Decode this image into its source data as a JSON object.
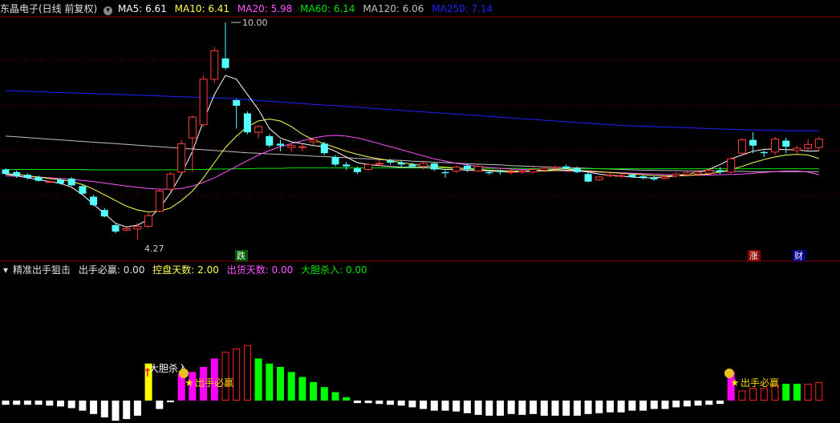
{
  "header": {
    "stock_title": "东晶电子(日线 前复权)",
    "ma5": "MA5: 6.61",
    "ma10": "MA10: 6.41",
    "ma20": "MA20: 5.98",
    "ma60": "MA60: 6.14",
    "ma120": "MA120: 6.06",
    "ma250": "MA250: 7.14"
  },
  "colors": {
    "up": "#ff3c3c",
    "down": "#54ffff",
    "ma5": "#ffffff",
    "ma10": "#ffff54",
    "ma20": "#ff54ff",
    "ma60": "#00e600",
    "ma120": "#c0c0c0",
    "ma250": "#2020ff",
    "grid": "#8b0000"
  },
  "indicator": {
    "title": "精准出手狙击",
    "v1": "出手必赢: 0.00",
    "v2": "控盘天数: 2.00",
    "v3": "出货天数: 0.00",
    "v4": "大胆杀入: 0.00"
  },
  "markers": {
    "high_label": "10.00",
    "low_label": "4.27",
    "die": "跌",
    "zhang": "涨",
    "cai": "财"
  },
  "signals": {
    "dadan": "大胆杀入",
    "bishou1": "出手必赢",
    "bishou2": "出手必赢"
  },
  "chart_data": [
    {
      "type": "candlestick",
      "title": "东晶电子(日线 前复权)",
      "candles": [
        {
          "o": 6.12,
          "c": 6.0,
          "h": 6.15,
          "l": 5.98
        },
        {
          "o": 6.05,
          "c": 5.95,
          "h": 6.1,
          "l": 5.9
        },
        {
          "o": 5.98,
          "c": 5.9,
          "h": 6.02,
          "l": 5.85
        },
        {
          "o": 5.92,
          "c": 5.82,
          "h": 5.96,
          "l": 5.8
        },
        {
          "o": 5.8,
          "c": 5.8,
          "h": 5.84,
          "l": 5.76
        },
        {
          "o": 5.85,
          "c": 5.75,
          "h": 5.88,
          "l": 5.72
        },
        {
          "o": 5.88,
          "c": 5.7,
          "h": 5.92,
          "l": 5.68
        },
        {
          "o": 5.68,
          "c": 5.48,
          "h": 5.72,
          "l": 5.45
        },
        {
          "o": 5.4,
          "c": 5.18,
          "h": 5.45,
          "l": 5.15
        },
        {
          "o": 5.05,
          "c": 4.88,
          "h": 5.1,
          "l": 4.86
        },
        {
          "o": 4.65,
          "c": 4.48,
          "h": 4.7,
          "l": 4.44
        },
        {
          "o": 4.52,
          "c": 4.56,
          "h": 4.6,
          "l": 4.48
        },
        {
          "o": 4.55,
          "c": 4.62,
          "h": 4.7,
          "l": 4.27
        },
        {
          "o": 4.62,
          "c": 4.9,
          "h": 4.98,
          "l": 4.58
        },
        {
          "o": 5.02,
          "c": 5.55,
          "h": 5.6,
          "l": 4.98
        },
        {
          "o": 5.6,
          "c": 6.0,
          "h": 6.05,
          "l": 5.55
        },
        {
          "o": 6.05,
          "c": 6.8,
          "h": 6.9,
          "l": 6.0
        },
        {
          "o": 6.95,
          "c": 7.5,
          "h": 7.55,
          "l": 6.05
        },
        {
          "o": 7.3,
          "c": 8.5,
          "h": 8.6,
          "l": 7.25
        },
        {
          "o": 8.5,
          "c": 9.25,
          "h": 9.35,
          "l": 8.4
        },
        {
          "o": 9.05,
          "c": 8.8,
          "h": 10.0,
          "l": 8.75
        },
        {
          "o": 7.95,
          "c": 7.8,
          "h": 7.98,
          "l": 7.2
        },
        {
          "o": 7.6,
          "c": 7.1,
          "h": 7.65,
          "l": 7.05
        },
        {
          "o": 7.1,
          "c": 7.25,
          "h": 7.3,
          "l": 6.95
        },
        {
          "o": 7.0,
          "c": 6.75,
          "h": 7.05,
          "l": 6.7
        },
        {
          "o": 6.8,
          "c": 6.75,
          "h": 6.9,
          "l": 6.6
        },
        {
          "o": 6.7,
          "c": 6.75,
          "h": 6.82,
          "l": 6.58
        },
        {
          "o": 6.72,
          "c": 6.72,
          "h": 6.8,
          "l": 6.6
        },
        {
          "o": 6.85,
          "c": 6.9,
          "h": 6.95,
          "l": 6.75
        },
        {
          "o": 6.8,
          "c": 6.55,
          "h": 6.85,
          "l": 6.5
        },
        {
          "o": 6.45,
          "c": 6.25,
          "h": 6.5,
          "l": 6.2
        },
        {
          "o": 6.25,
          "c": 6.2,
          "h": 6.32,
          "l": 6.1
        },
        {
          "o": 6.15,
          "c": 6.05,
          "h": 6.2,
          "l": 6.0
        },
        {
          "o": 6.12,
          "c": 6.25,
          "h": 6.3,
          "l": 6.08
        },
        {
          "o": 6.28,
          "c": 6.28,
          "h": 6.38,
          "l": 6.2
        },
        {
          "o": 6.35,
          "c": 6.3,
          "h": 6.4,
          "l": 6.25
        },
        {
          "o": 6.3,
          "c": 6.25,
          "h": 6.35,
          "l": 6.18
        },
        {
          "o": 6.25,
          "c": 6.2,
          "h": 6.3,
          "l": 6.15
        },
        {
          "o": 6.2,
          "c": 6.28,
          "h": 6.35,
          "l": 6.12
        },
        {
          "o": 6.28,
          "c": 6.12,
          "h": 6.32,
          "l": 6.08
        },
        {
          "o": 6.05,
          "c": 6.02,
          "h": 6.1,
          "l": 5.9
        },
        {
          "o": 6.08,
          "c": 6.18,
          "h": 6.22,
          "l": 6.02
        },
        {
          "o": 6.22,
          "c": 6.12,
          "h": 6.28,
          "l": 6.05
        },
        {
          "o": 6.08,
          "c": 6.2,
          "h": 6.25,
          "l": 6.05
        },
        {
          "o": 6.05,
          "c": 6.02,
          "h": 6.1,
          "l": 5.98
        },
        {
          "o": 6.08,
          "c": 6.05,
          "h": 6.12,
          "l": 5.98
        },
        {
          "o": 6.06,
          "c": 6.06,
          "h": 6.12,
          "l": 5.98
        },
        {
          "o": 6.05,
          "c": 6.08,
          "h": 6.12,
          "l": 6.0
        },
        {
          "o": 6.05,
          "c": 6.12,
          "h": 6.18,
          "l": 6.02
        },
        {
          "o": 6.1,
          "c": 6.15,
          "h": 6.2,
          "l": 6.05
        },
        {
          "o": 6.15,
          "c": 6.18,
          "h": 6.22,
          "l": 6.1
        },
        {
          "o": 6.2,
          "c": 6.15,
          "h": 6.25,
          "l": 6.12
        },
        {
          "o": 6.15,
          "c": 6.05,
          "h": 6.2,
          "l": 6.02
        },
        {
          "o": 6.0,
          "c": 5.8,
          "h": 6.05,
          "l": 5.78
        },
        {
          "o": 5.85,
          "c": 5.92,
          "h": 5.95,
          "l": 5.82
        },
        {
          "o": 5.95,
          "c": 5.98,
          "h": 6.02,
          "l": 5.92
        },
        {
          "o": 5.96,
          "c": 5.96,
          "h": 6.02,
          "l": 5.9
        },
        {
          "o": 5.98,
          "c": 5.92,
          "h": 6.02,
          "l": 5.9
        },
        {
          "o": 5.94,
          "c": 5.9,
          "h": 5.98,
          "l": 5.86
        },
        {
          "o": 5.9,
          "c": 5.86,
          "h": 5.94,
          "l": 5.82
        },
        {
          "o": 5.88,
          "c": 5.92,
          "h": 5.96,
          "l": 5.85
        },
        {
          "o": 5.95,
          "c": 6.0,
          "h": 6.05,
          "l": 5.9
        },
        {
          "o": 5.98,
          "c": 6.03,
          "h": 6.06,
          "l": 5.94
        },
        {
          "o": 6.0,
          "c": 6.05,
          "h": 6.12,
          "l": 5.96
        },
        {
          "o": 6.02,
          "c": 6.1,
          "h": 6.15,
          "l": 6.0
        },
        {
          "o": 6.1,
          "c": 6.05,
          "h": 6.18,
          "l": 6.0
        },
        {
          "o": 6.05,
          "c": 6.4,
          "h": 6.45,
          "l": 6.02
        },
        {
          "o": 6.55,
          "c": 6.9,
          "h": 6.95,
          "l": 6.5
        },
        {
          "o": 6.9,
          "c": 6.75,
          "h": 7.1,
          "l": 6.55
        },
        {
          "o": 6.58,
          "c": 6.55,
          "h": 6.62,
          "l": 6.45
        },
        {
          "o": 6.58,
          "c": 6.92,
          "h": 6.98,
          "l": 6.5
        },
        {
          "o": 6.88,
          "c": 6.72,
          "h": 6.95,
          "l": 6.55
        },
        {
          "o": 6.62,
          "c": 6.68,
          "h": 6.75,
          "l": 6.55
        },
        {
          "o": 6.68,
          "c": 6.78,
          "h": 6.92,
          "l": 6.62
        },
        {
          "o": 6.7,
          "c": 6.92,
          "h": 6.98,
          "l": 6.62
        }
      ],
      "ma5": [
        6.0,
        5.95,
        5.9,
        5.85,
        5.8,
        5.75,
        5.65,
        5.45,
        5.2,
        4.95,
        4.7,
        4.6,
        4.65,
        4.8,
        5.1,
        5.5,
        6.0,
        6.6,
        7.4,
        8.1,
        8.6,
        8.5,
        8.1,
        7.7,
        7.2,
        6.95,
        6.85,
        6.8,
        6.75,
        6.72,
        6.6,
        6.45,
        6.3,
        6.25,
        6.22,
        6.2,
        6.18,
        6.18,
        6.18,
        6.15,
        6.12,
        6.12,
        6.1,
        6.1,
        6.08,
        6.06,
        6.05,
        6.06,
        6.08,
        6.1,
        6.12,
        6.14,
        6.1,
        6.05,
        6.0,
        5.96,
        5.94,
        5.92,
        5.9,
        5.9,
        5.92,
        5.95,
        6.0,
        6.05,
        6.12,
        6.25,
        6.4,
        6.5,
        6.6,
        6.65,
        6.66,
        6.64,
        6.64,
        6.6,
        6.61
      ],
      "ma10": [
        6.0,
        6.0,
        5.95,
        5.92,
        5.88,
        5.85,
        5.8,
        5.72,
        5.6,
        5.45,
        5.3,
        5.15,
        5.05,
        5.0,
        5.02,
        5.1,
        5.3,
        5.55,
        5.9,
        6.3,
        6.7,
        7.0,
        7.25,
        7.4,
        7.45,
        7.4,
        7.25,
        7.05,
        6.9,
        6.8,
        6.7,
        6.6,
        6.52,
        6.45,
        6.4,
        6.35,
        6.3,
        6.26,
        6.22,
        6.2,
        6.18,
        6.16,
        6.14,
        6.12,
        6.1,
        6.09,
        6.08,
        6.08,
        6.08,
        6.08,
        6.09,
        6.1,
        6.09,
        6.08,
        6.06,
        6.04,
        6.02,
        6.0,
        5.98,
        5.96,
        5.95,
        5.95,
        5.96,
        5.98,
        6.0,
        6.05,
        6.12,
        6.2,
        6.3,
        6.38,
        6.45,
        6.5,
        6.52,
        6.5,
        6.41
      ],
      "ma20": [
        5.95,
        5.94,
        5.93,
        5.92,
        5.9,
        5.88,
        5.86,
        5.83,
        5.8,
        5.76,
        5.72,
        5.68,
        5.65,
        5.62,
        5.6,
        5.6,
        5.62,
        5.68,
        5.78,
        5.9,
        6.05,
        6.2,
        6.35,
        6.5,
        6.62,
        6.72,
        6.8,
        6.88,
        6.95,
        7.0,
        7.02,
        7.0,
        6.95,
        6.88,
        6.8,
        6.72,
        6.64,
        6.56,
        6.48,
        6.4,
        6.34,
        6.28,
        6.24,
        6.2,
        6.17,
        6.15,
        6.13,
        6.12,
        6.11,
        6.1,
        6.09,
        6.08,
        6.07,
        6.06,
        6.05,
        6.04,
        6.03,
        6.02,
        6.01,
        6.0,
        5.99,
        5.98,
        5.97,
        5.97,
        5.97,
        5.98,
        5.99,
        6.0,
        6.02,
        6.04,
        6.06,
        6.08,
        6.08,
        6.05,
        5.98
      ],
      "ma60": [
        6.12,
        6.12,
        6.12,
        6.12,
        6.12,
        6.12,
        6.12,
        6.12,
        6.11,
        6.11,
        6.11,
        6.11,
        6.11,
        6.11,
        6.11,
        6.11,
        6.12,
        6.12,
        6.12,
        6.13,
        6.13,
        6.14,
        6.14,
        6.15,
        6.15,
        6.15,
        6.16,
        6.16,
        6.16,
        6.16,
        6.16,
        6.16,
        6.16,
        6.16,
        6.16,
        6.16,
        6.16,
        6.16,
        6.16,
        6.16,
        6.16,
        6.15,
        6.15,
        6.15,
        6.15,
        6.15,
        6.15,
        6.15,
        6.14,
        6.14,
        6.14,
        6.14,
        6.14,
        6.14,
        6.14,
        6.14,
        6.14,
        6.14,
        6.14,
        6.14,
        6.14,
        6.14,
        6.14,
        6.14,
        6.14,
        6.14,
        6.14,
        6.14,
        6.14,
        6.14,
        6.14,
        6.14,
        6.14,
        6.14,
        6.14
      ],
      "ma120": [
        7.0,
        6.98,
        6.96,
        6.94,
        6.92,
        6.9,
        6.88,
        6.86,
        6.84,
        6.82,
        6.8,
        6.78,
        6.76,
        6.74,
        6.72,
        6.7,
        6.68,
        6.66,
        6.64,
        6.62,
        6.6,
        6.58,
        6.56,
        6.55,
        6.53,
        6.52,
        6.5,
        6.49,
        6.47,
        6.46,
        6.44,
        6.43,
        6.41,
        6.4,
        6.38,
        6.37,
        6.36,
        6.34,
        6.33,
        6.31,
        6.3,
        6.29,
        6.27,
        6.26,
        6.25,
        6.24,
        6.22,
        6.21,
        6.2,
        6.19,
        6.18,
        6.17,
        6.16,
        6.15,
        6.14,
        6.13,
        6.12,
        6.11,
        6.1,
        6.1,
        6.09,
        6.09,
        6.08,
        6.08,
        6.08,
        6.07,
        6.07,
        6.07,
        6.06,
        6.06,
        6.06,
        6.06,
        6.06,
        6.06,
        6.06
      ],
      "ma250": [
        8.2,
        8.19,
        8.18,
        8.17,
        8.16,
        8.15,
        8.14,
        8.13,
        8.12,
        8.11,
        8.1,
        8.09,
        8.08,
        8.07,
        8.06,
        8.05,
        8.04,
        8.03,
        8.02,
        8.01,
        8.0,
        7.98,
        7.96,
        7.94,
        7.92,
        7.9,
        7.88,
        7.86,
        7.84,
        7.82,
        7.8,
        7.78,
        7.76,
        7.74,
        7.72,
        7.7,
        7.68,
        7.66,
        7.64,
        7.62,
        7.6,
        7.58,
        7.56,
        7.54,
        7.52,
        7.5,
        7.48,
        7.46,
        7.44,
        7.42,
        7.4,
        7.38,
        7.36,
        7.34,
        7.32,
        7.3,
        7.28,
        7.27,
        7.26,
        7.25,
        7.24,
        7.23,
        7.22,
        7.21,
        7.2,
        7.19,
        7.18,
        7.17,
        7.16,
        7.15,
        7.15,
        7.14,
        7.14,
        7.14,
        7.14
      ]
    },
    {
      "type": "bar",
      "title": "精准出手狙击",
      "bars": [
        {
          "v": -0.5,
          "k": "w"
        },
        {
          "v": -0.5,
          "k": "w"
        },
        {
          "v": -0.5,
          "k": "w"
        },
        {
          "v": -0.5,
          "k": "w"
        },
        {
          "v": -0.6,
          "k": "w"
        },
        {
          "v": -0.7,
          "k": "w"
        },
        {
          "v": -0.9,
          "k": "w"
        },
        {
          "v": -1.2,
          "k": "w"
        },
        {
          "v": -1.6,
          "k": "w"
        },
        {
          "v": -2.0,
          "k": "w"
        },
        {
          "v": -2.4,
          "k": "w"
        },
        {
          "v": -2.2,
          "k": "w"
        },
        {
          "v": -1.8,
          "k": "w"
        },
        {
          "v": 4.4,
          "k": "y"
        },
        {
          "v": -1.0,
          "k": "w"
        },
        {
          "v": -0.2,
          "k": "w"
        },
        {
          "v": 3.2,
          "k": "m"
        },
        {
          "v": 3.4,
          "k": "m"
        },
        {
          "v": 4.0,
          "k": "m"
        },
        {
          "v": 5.0,
          "k": "m"
        },
        {
          "v": 5.8,
          "k": "r"
        },
        {
          "v": 6.2,
          "k": "r"
        },
        {
          "v": 6.6,
          "k": "r"
        },
        {
          "v": 5.0,
          "k": "g"
        },
        {
          "v": 4.4,
          "k": "g"
        },
        {
          "v": 4.0,
          "k": "g"
        },
        {
          "v": 3.4,
          "k": "g"
        },
        {
          "v": 2.8,
          "k": "g"
        },
        {
          "v": 2.2,
          "k": "g"
        },
        {
          "v": 1.6,
          "k": "g"
        },
        {
          "v": 1.0,
          "k": "g"
        },
        {
          "v": 0.4,
          "k": "g"
        },
        {
          "v": -0.3,
          "k": "w"
        },
        {
          "v": -0.3,
          "k": "w"
        },
        {
          "v": -0.4,
          "k": "w"
        },
        {
          "v": -0.5,
          "k": "w"
        },
        {
          "v": -0.6,
          "k": "w"
        },
        {
          "v": -0.8,
          "k": "w"
        },
        {
          "v": -1.0,
          "k": "w"
        },
        {
          "v": -1.2,
          "k": "w"
        },
        {
          "v": -1.2,
          "k": "w"
        },
        {
          "v": -1.3,
          "k": "w"
        },
        {
          "v": -1.5,
          "k": "w"
        },
        {
          "v": -1.7,
          "k": "w"
        },
        {
          "v": -1.8,
          "k": "w"
        },
        {
          "v": -1.8,
          "k": "w"
        },
        {
          "v": -1.6,
          "k": "w"
        },
        {
          "v": -1.7,
          "k": "w"
        },
        {
          "v": -1.6,
          "k": "w"
        },
        {
          "v": -1.8,
          "k": "w"
        },
        {
          "v": -1.8,
          "k": "w"
        },
        {
          "v": -1.8,
          "k": "w"
        },
        {
          "v": -1.8,
          "k": "w"
        },
        {
          "v": -1.6,
          "k": "w"
        },
        {
          "v": -1.5,
          "k": "w"
        },
        {
          "v": -1.4,
          "k": "w"
        },
        {
          "v": -1.4,
          "k": "w"
        },
        {
          "v": -1.2,
          "k": "w"
        },
        {
          "v": -1.2,
          "k": "w"
        },
        {
          "v": -1.0,
          "k": "w"
        },
        {
          "v": -1.0,
          "k": "w"
        },
        {
          "v": -0.8,
          "k": "w"
        },
        {
          "v": -0.7,
          "k": "w"
        },
        {
          "v": -0.6,
          "k": "w"
        },
        {
          "v": -0.5,
          "k": "w"
        },
        {
          "v": -0.4,
          "k": "w"
        },
        {
          "v": 3.4,
          "k": "m"
        },
        {
          "v": 1.2,
          "k": "r"
        },
        {
          "v": 1.5,
          "k": "r"
        },
        {
          "v": 1.5,
          "k": "r"
        },
        {
          "v": 1.8,
          "k": "r"
        },
        {
          "v": 2.0,
          "k": "g"
        },
        {
          "v": 2.0,
          "k": "g"
        },
        {
          "v": 2.0,
          "k": "r"
        },
        {
          "v": 2.2,
          "k": "r"
        }
      ]
    }
  ]
}
